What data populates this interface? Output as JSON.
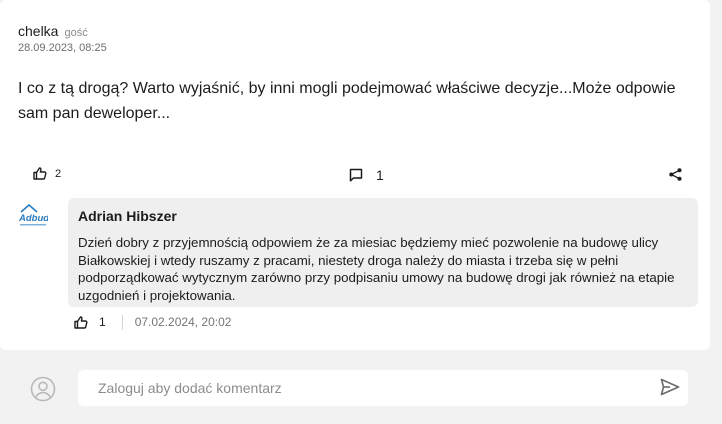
{
  "post": {
    "author": "chelka",
    "role": "gość",
    "date": "28.09.2023, 08:25",
    "body": "I co z tą drogą? Warto wyjaśnić, by inni mogli podejmować właściwe decyzje...Może odpowie sam pan deweloper...",
    "likes": "2",
    "comments": "1",
    "icons": {
      "like": "thumbs-up-icon",
      "comment": "comment-icon",
      "share": "share-icon"
    }
  },
  "reply": {
    "logo_text": "Adbud",
    "author": "Adrian Hibszer",
    "body": "Dzień dobry z przyjemnością odpowiem że za miesiac będziemy mieć pozwolenie na budowę ulicy Białkowskiej i wtedy ruszamy z pracami, niestety droga należy do miasta i trzeba się w pełni podporządkować wytycznym zarówno przy podpisaniu umowy na budowę drogi jak również na etapie uzgodnień i projektowania.",
    "likes": "1",
    "date": "07.02.2024, 20:02"
  },
  "compose": {
    "placeholder": "Zaloguj aby dodać komentarz",
    "icons": {
      "avatar": "user-avatar-icon",
      "send": "send-icon"
    }
  },
  "colors": {
    "page_bg": "#f2f2f2",
    "card_bg": "#ffffff",
    "bubble_bg": "#efefef",
    "muted": "#8a8a8a",
    "logo_blue": "#2a7bbf"
  }
}
